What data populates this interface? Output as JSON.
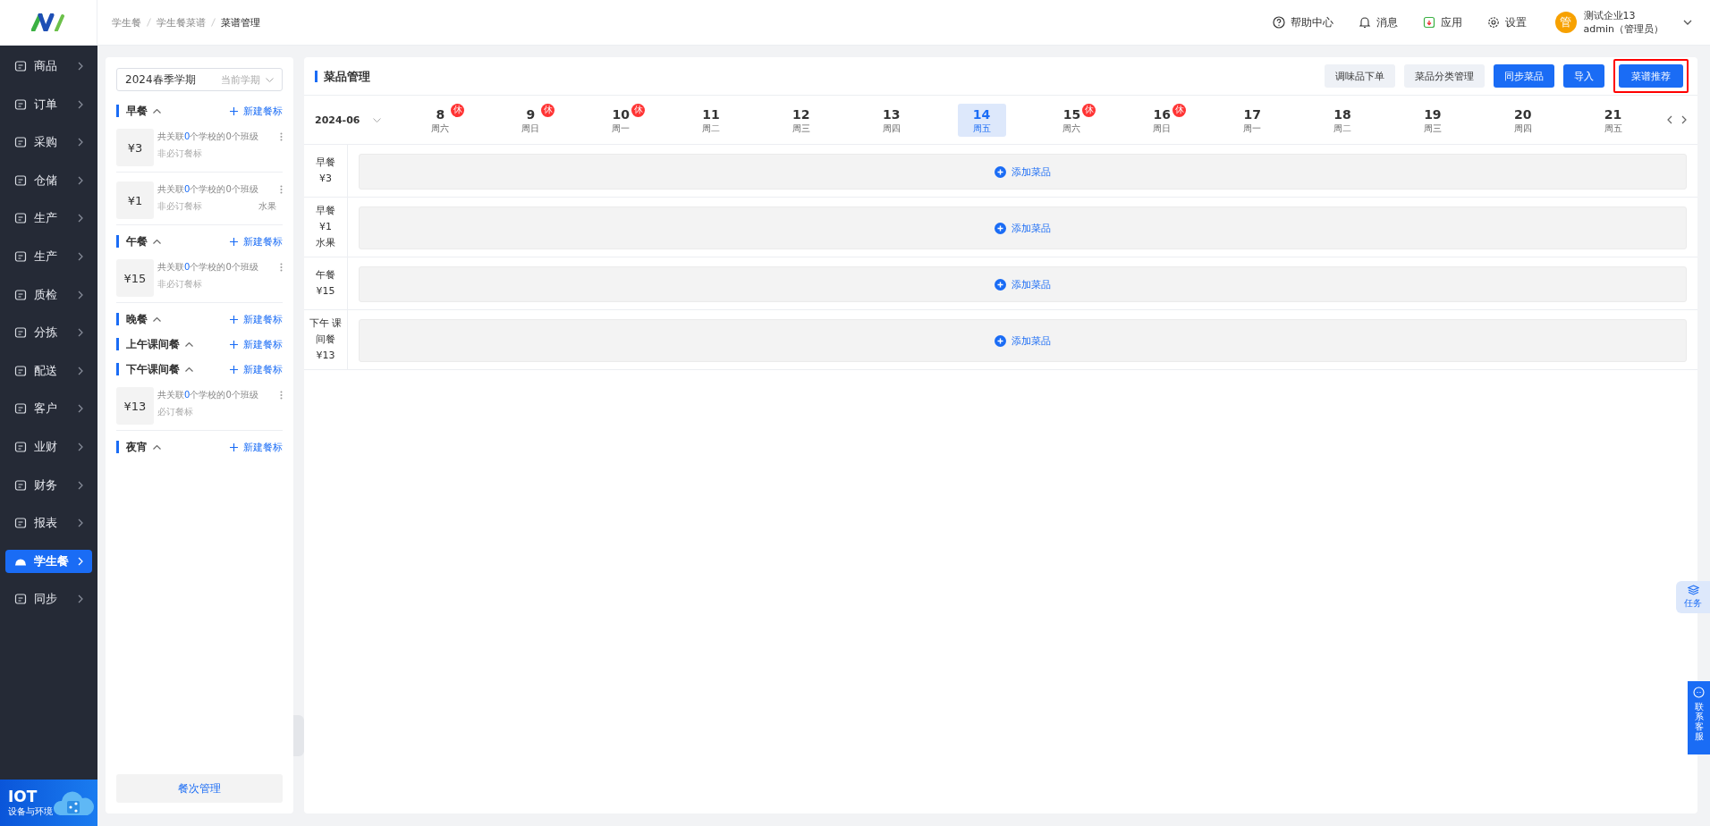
{
  "header": {
    "breadcrumb": [
      {
        "label": "学生餐",
        "current": false
      },
      {
        "label": "学生餐菜谱",
        "current": false
      },
      {
        "label": "菜谱管理",
        "current": true
      }
    ],
    "actions": [
      {
        "label": "帮助中心"
      },
      {
        "label": "消息"
      },
      {
        "label": "应用"
      },
      {
        "label": "设置"
      }
    ],
    "user": {
      "avatar": "管",
      "company": "测试企业13",
      "name": "admin（管理员）"
    }
  },
  "nav": [
    {
      "label": "商品",
      "selected": false
    },
    {
      "label": "订单",
      "selected": false
    },
    {
      "label": "采购",
      "selected": false
    },
    {
      "label": "仓储",
      "selected": false
    },
    {
      "label": "生产",
      "selected": false
    },
    {
      "label": "生产",
      "selected": false
    },
    {
      "label": "质检",
      "selected": false
    },
    {
      "label": "分拣",
      "selected": false
    },
    {
      "label": "配送",
      "selected": false
    },
    {
      "label": "客户",
      "selected": false
    },
    {
      "label": "业财",
      "selected": false
    },
    {
      "label": "财务",
      "selected": false
    },
    {
      "label": "报表",
      "selected": false
    },
    {
      "label": "学生餐",
      "selected": true
    },
    {
      "label": "同步",
      "selected": false
    }
  ],
  "promo": {
    "title": "IOT",
    "subtitle": "设备与环境"
  },
  "meal_panel": {
    "term": "2024春季学期",
    "term_tag": "当前学期",
    "groups": [
      {
        "name": "早餐",
        "add_label": "新建餐标",
        "items": [
          {
            "price": "¥3",
            "before": "共关联",
            "count": "0",
            "after": "个学校的0个班级",
            "type": "非必订餐标"
          },
          {
            "price": "¥1",
            "before": "共关联",
            "count": "0",
            "after": "个学校的0个班级",
            "type": "非必订餐标",
            "tag": "水果"
          }
        ]
      },
      {
        "name": "午餐",
        "add_label": "新建餐标",
        "items": [
          {
            "price": "¥15",
            "before": "共关联",
            "count": "0",
            "after": "个学校的0个班级",
            "type": "非必订餐标"
          }
        ]
      },
      {
        "name": "晚餐",
        "add_label": "新建餐标"
      },
      {
        "name": "上午课间餐",
        "add_label": "新建餐标"
      },
      {
        "name": "下午课间餐",
        "add_label": "新建餐标",
        "items": [
          {
            "price": "¥13",
            "before": "共关联",
            "count": "0",
            "after": "个学校的0个班级",
            "type": "必订餐标"
          }
        ]
      },
      {
        "name": "夜宵",
        "add_label": "新建餐标"
      }
    ],
    "manage_button": "餐次管理"
  },
  "main": {
    "title": "菜品管理",
    "buttons": [
      {
        "label": "调味品下单",
        "kind": "secondary",
        "highlighted": false
      },
      {
        "label": "菜品分类管理",
        "kind": "secondary",
        "highlighted": false
      },
      {
        "label": "同步菜品",
        "kind": "primary",
        "highlighted": false
      },
      {
        "label": "导入",
        "kind": "primary",
        "highlighted": false
      },
      {
        "label": "菜谱推荐",
        "kind": "primary",
        "highlighted": true
      }
    ],
    "month": "2024-06",
    "dates": [
      {
        "day": "8",
        "weekday": "周六",
        "badge": "休",
        "selected": false
      },
      {
        "day": "9",
        "weekday": "周日",
        "badge": "休",
        "selected": false
      },
      {
        "day": "10",
        "weekday": "周一",
        "badge": "休",
        "selected": false
      },
      {
        "day": "11",
        "weekday": "周二",
        "selected": false
      },
      {
        "day": "12",
        "weekday": "周三",
        "selected": false
      },
      {
        "day": "13",
        "weekday": "周四",
        "selected": false
      },
      {
        "day": "14",
        "weekday": "周五",
        "selected": true
      },
      {
        "day": "15",
        "weekday": "周六",
        "badge": "休",
        "selected": false
      },
      {
        "day": "16",
        "weekday": "周日",
        "badge": "休",
        "selected": false
      },
      {
        "day": "17",
        "weekday": "周一",
        "selected": false
      },
      {
        "day": "18",
        "weekday": "周二",
        "selected": false
      },
      {
        "day": "19",
        "weekday": "周三",
        "selected": false
      },
      {
        "day": "20",
        "weekday": "周四",
        "selected": false
      },
      {
        "day": "21",
        "weekday": "周五",
        "selected": false
      }
    ],
    "rows": [
      {
        "label_lines": [
          "早餐",
          "¥3"
        ],
        "add_label": "添加菜品"
      },
      {
        "label_lines": [
          "早餐",
          "¥1",
          "水果"
        ],
        "add_label": "添加菜品"
      },
      {
        "label_lines": [
          "午餐",
          "¥15"
        ],
        "add_label": "添加菜品"
      },
      {
        "label_lines": [
          "下午 课",
          "间餐",
          "¥13"
        ],
        "add_label": "添加菜品"
      }
    ]
  },
  "float": {
    "task": "任务",
    "service": "联系客服"
  }
}
